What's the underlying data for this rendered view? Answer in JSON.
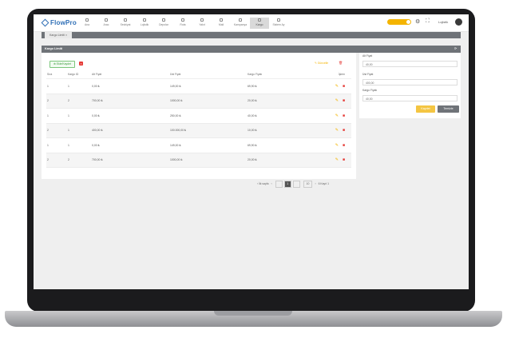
{
  "app": {
    "logo": "FlowPro"
  },
  "nav": [
    {
      "label": "Ana",
      "icon": "home-icon"
    },
    {
      "label": "Arac",
      "icon": "truck-icon"
    },
    {
      "label": "Sevkiyat",
      "icon": "box-icon"
    },
    {
      "label": "Lojistik",
      "icon": "route-icon"
    },
    {
      "label": "Depolar",
      "icon": "warehouse-icon"
    },
    {
      "label": "Rota",
      "icon": "map-icon"
    },
    {
      "label": "Yakıt",
      "icon": "fuel-icon"
    },
    {
      "label": "Mali",
      "icon": "money-icon"
    },
    {
      "label": "Kampanya",
      "icon": "tag-icon"
    },
    {
      "label": "Kargo",
      "icon": "package-icon",
      "active": true
    },
    {
      "label": "Sistem Ay",
      "icon": "gear-icon"
    }
  ],
  "header": {
    "username": "Lojistik",
    "theme_toggle": "on"
  },
  "tabbar": {
    "tab": "Kargo Limiti ×"
  },
  "card": {
    "title": "Kargo Limiti",
    "refresh_icon": "refresh-icon"
  },
  "toolbar": {
    "add_label": "Ekle/Kaydet",
    "update_label": "✎ Güncelle"
  },
  "table": {
    "headers": [
      "Sıra",
      "Kargo ID",
      "Alt Fiyat",
      "Üst Fiyat",
      "Kargo Fiyatı",
      "İşlem"
    ],
    "rows": [
      [
        "1",
        "1",
        "0,00 ₺",
        "149,00 ₺",
        "69,90 ₺"
      ],
      [
        "2",
        "2",
        "700,00 ₺",
        "1000,00 ₺",
        "20,00 ₺"
      ],
      [
        "1",
        "1",
        "0,00 ₺",
        "250,00 ₺",
        "40,00 ₺"
      ],
      [
        "2",
        "1",
        "400,00 ₺",
        "100.000,00 ₺",
        "10,00 ₺"
      ],
      [
        "1",
        "1",
        "0,00 ₺",
        "149,00 ₺",
        "69,90 ₺"
      ],
      [
        "2",
        "2",
        "700,00 ₺",
        "1000,00 ₺",
        "20,00 ₺"
      ]
    ]
  },
  "pager": {
    "first": "‹ İlk sayfa",
    "prev": "‹",
    "page": "1",
    "next": "›",
    "per_page": "10",
    "last": "›",
    "total": "6 Kayıt 1"
  },
  "filter": {
    "min_label": "Alt Fiyat",
    "min_value": "40,00",
    "max_label": "Üst Fiyat",
    "max_value": "400,00",
    "price_label": "Kargo Fiyatı",
    "price_value": "40,00",
    "save_label": "Kaydet",
    "clear_label": "Temizle"
  },
  "colors": {
    "accent": "#f4b400",
    "brand": "#2f6fb6",
    "header": "#6f7378",
    "danger": "#e53935"
  }
}
